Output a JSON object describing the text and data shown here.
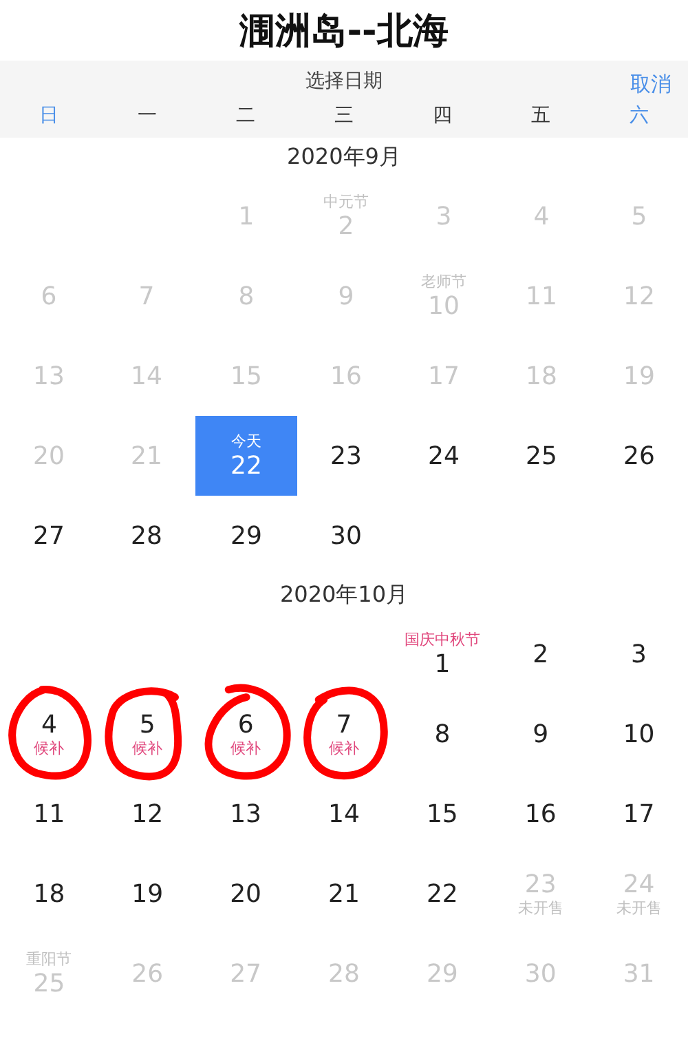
{
  "title": "涠洲岛--北海",
  "picker": {
    "heading": "选择日期",
    "cancel": "取消"
  },
  "weekdays": [
    {
      "label": "日",
      "weekend": true
    },
    {
      "label": "一",
      "weekend": false
    },
    {
      "label": "二",
      "weekend": false
    },
    {
      "label": "三",
      "weekend": false
    },
    {
      "label": "四",
      "weekend": false
    },
    {
      "label": "五",
      "weekend": false
    },
    {
      "label": "六",
      "weekend": true
    }
  ],
  "months": [
    {
      "title": "2020年9月",
      "days": [
        {
          "kind": "blank"
        },
        {
          "kind": "blank"
        },
        {
          "kind": "past",
          "day": "1"
        },
        {
          "kind": "past",
          "day": "2",
          "top": "中元节"
        },
        {
          "kind": "past",
          "day": "3"
        },
        {
          "kind": "past",
          "day": "4"
        },
        {
          "kind": "past",
          "day": "5"
        },
        {
          "kind": "past",
          "day": "6"
        },
        {
          "kind": "past",
          "day": "7"
        },
        {
          "kind": "past",
          "day": "8"
        },
        {
          "kind": "past",
          "day": "9"
        },
        {
          "kind": "past",
          "day": "10",
          "top": "老师节"
        },
        {
          "kind": "past",
          "day": "11"
        },
        {
          "kind": "past",
          "day": "12"
        },
        {
          "kind": "past",
          "day": "13"
        },
        {
          "kind": "past",
          "day": "14"
        },
        {
          "kind": "past",
          "day": "15"
        },
        {
          "kind": "past",
          "day": "16"
        },
        {
          "kind": "past",
          "day": "17"
        },
        {
          "kind": "past",
          "day": "18"
        },
        {
          "kind": "past",
          "day": "19"
        },
        {
          "kind": "past",
          "day": "20"
        },
        {
          "kind": "past",
          "day": "21"
        },
        {
          "kind": "today",
          "day": "22",
          "top": "今天"
        },
        {
          "kind": "open",
          "day": "23"
        },
        {
          "kind": "open",
          "day": "24"
        },
        {
          "kind": "open",
          "day": "25"
        },
        {
          "kind": "open",
          "day": "26"
        },
        {
          "kind": "open",
          "day": "27"
        },
        {
          "kind": "open",
          "day": "28"
        },
        {
          "kind": "open",
          "day": "29"
        },
        {
          "kind": "open",
          "day": "30"
        }
      ]
    },
    {
      "title": "2020年10月",
      "days": [
        {
          "kind": "blank"
        },
        {
          "kind": "blank"
        },
        {
          "kind": "blank"
        },
        {
          "kind": "blank"
        },
        {
          "kind": "open",
          "day": "1",
          "top": "国庆中秋节"
        },
        {
          "kind": "open",
          "day": "2"
        },
        {
          "kind": "open",
          "day": "3"
        },
        {
          "kind": "open",
          "day": "4",
          "bottom": "候补",
          "circled": true
        },
        {
          "kind": "open",
          "day": "5",
          "bottom": "候补",
          "circled": true
        },
        {
          "kind": "open",
          "day": "6",
          "bottom": "候补",
          "circled": true
        },
        {
          "kind": "open",
          "day": "7",
          "bottom": "候补",
          "circled": true
        },
        {
          "kind": "open",
          "day": "8"
        },
        {
          "kind": "open",
          "day": "9"
        },
        {
          "kind": "open",
          "day": "10"
        },
        {
          "kind": "open",
          "day": "11"
        },
        {
          "kind": "open",
          "day": "12"
        },
        {
          "kind": "open",
          "day": "13"
        },
        {
          "kind": "open",
          "day": "14"
        },
        {
          "kind": "open",
          "day": "15"
        },
        {
          "kind": "open",
          "day": "16"
        },
        {
          "kind": "open",
          "day": "17"
        },
        {
          "kind": "open",
          "day": "18"
        },
        {
          "kind": "open",
          "day": "19"
        },
        {
          "kind": "open",
          "day": "20"
        },
        {
          "kind": "open",
          "day": "21"
        },
        {
          "kind": "open",
          "day": "22"
        },
        {
          "kind": "unavailable",
          "day": "23",
          "bottom": "未开售"
        },
        {
          "kind": "unavailable",
          "day": "24",
          "bottom": "未开售"
        },
        {
          "kind": "unavailable",
          "day": "25",
          "top": "重阳节"
        },
        {
          "kind": "unavailable",
          "day": "26"
        },
        {
          "kind": "unavailable",
          "day": "27"
        },
        {
          "kind": "unavailable",
          "day": "28"
        },
        {
          "kind": "unavailable",
          "day": "29"
        },
        {
          "kind": "unavailable",
          "day": "30"
        },
        {
          "kind": "unavailable",
          "day": "31"
        }
      ]
    }
  ]
}
